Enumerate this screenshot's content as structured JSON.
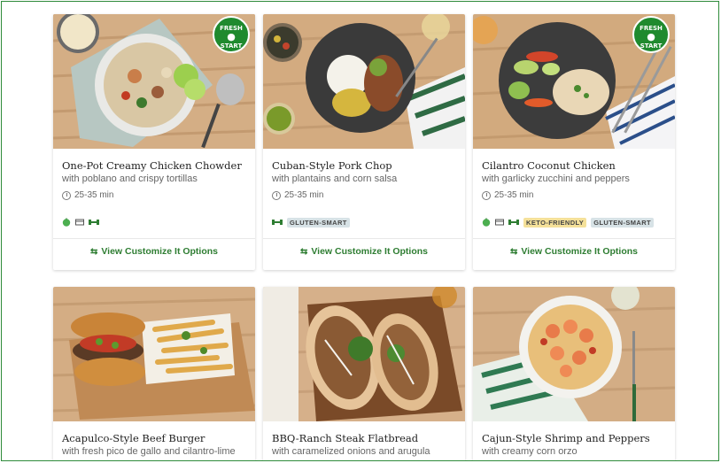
{
  "cards": [
    {
      "title": "One-Pot Creamy Chicken Chowder",
      "subtitle": "with poblano and crispy tortillas",
      "time": "25-35 min",
      "badge": [
        "FRESH",
        "START"
      ],
      "tags": [],
      "icons": [
        "apple-icon",
        "card-icon",
        "dumbbell-icon"
      ],
      "cta": "View Customize It Options"
    },
    {
      "title": "Cuban-Style Pork Chop",
      "subtitle": "with plantains and corn salsa",
      "time": "25-35 min",
      "badge": null,
      "tags": [
        "GLUTEN-SMART"
      ],
      "icons": [
        "dumbbell-icon"
      ],
      "cta": "View Customize It Options"
    },
    {
      "title": "Cilantro Coconut Chicken",
      "subtitle": "with garlicky zucchini and peppers",
      "time": "25-35 min",
      "badge": [
        "FRESH",
        "START"
      ],
      "tags": [
        "KETO-FRIENDLY",
        "GLUTEN-SMART"
      ],
      "icons": [
        "apple-icon",
        "card-icon",
        "dumbbell-icon"
      ],
      "cta": "View Customize It Options"
    },
    {
      "title": "Acapulco-Style Beef Burger",
      "subtitle": "with fresh pico de gallo and cilantro-lime",
      "time": "",
      "badge": null,
      "tags": [],
      "icons": [],
      "cta": ""
    },
    {
      "title": "BBQ-Ranch Steak Flatbread",
      "subtitle": "with caramelized onions and arugula",
      "time": "",
      "badge": null,
      "tags": [],
      "icons": [],
      "cta": ""
    },
    {
      "title": "Cajun-Style Shrimp and Peppers",
      "subtitle": "with creamy corn orzo",
      "time": "",
      "badge": null,
      "tags": [],
      "icons": [],
      "cta": ""
    }
  ],
  "colors": {
    "brand_green": "#2e7d32",
    "badge_green": "#1f8a2e",
    "keto": "#f5e19a",
    "gluten": "#d7e2e6"
  }
}
